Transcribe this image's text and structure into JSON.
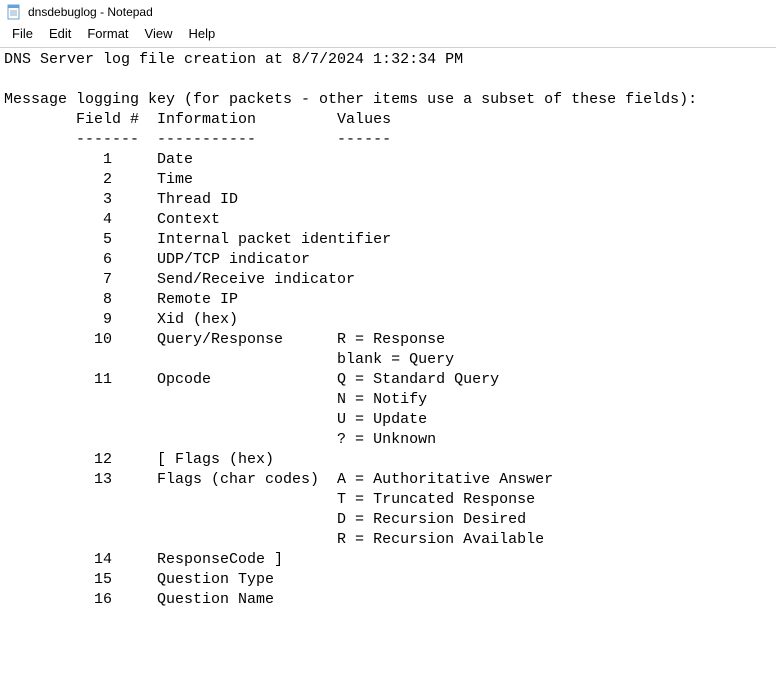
{
  "window": {
    "title": "dnsdebuglog - Notepad"
  },
  "menu": {
    "file": "File",
    "edit": "Edit",
    "format": "Format",
    "view": "View",
    "help": "Help"
  },
  "content": {
    "header_line": "DNS Server log file creation at 8/7/2024 1:32:34 PM",
    "blank1": "",
    "key_title": "Message logging key (for packets - other items use a subset of these fields):",
    "col_headers": "\tField #  Information         Values",
    "col_divider": "\t-------  -----------         ------",
    "r01": "\t   1     Date",
    "r02": "\t   2     Time",
    "r03": "\t   3     Thread ID",
    "r04": "\t   4     Context",
    "r05": "\t   5     Internal packet identifier",
    "r06": "\t   6     UDP/TCP indicator",
    "r07": "\t   7     Send/Receive indicator",
    "r08": "\t   8     Remote IP",
    "r09": "\t   9     Xid (hex)",
    "r10a": "\t  10     Query/Response      R = Response",
    "r10b": "\t                             blank = Query",
    "r11a": "\t  11     Opcode              Q = Standard Query",
    "r11b": "\t                             N = Notify",
    "r11c": "\t                             U = Update",
    "r11d": "\t                             ? = Unknown",
    "r12": "\t  12     [ Flags (hex)",
    "r13a": "\t  13     Flags (char codes)  A = Authoritative Answer",
    "r13b": "\t                             T = Truncated Response",
    "r13c": "\t                             D = Recursion Desired",
    "r13d": "\t                             R = Recursion Available",
    "r14": "\t  14     ResponseCode ]",
    "r15": "\t  15     Question Type",
    "r16": "\t  16     Question Name"
  }
}
